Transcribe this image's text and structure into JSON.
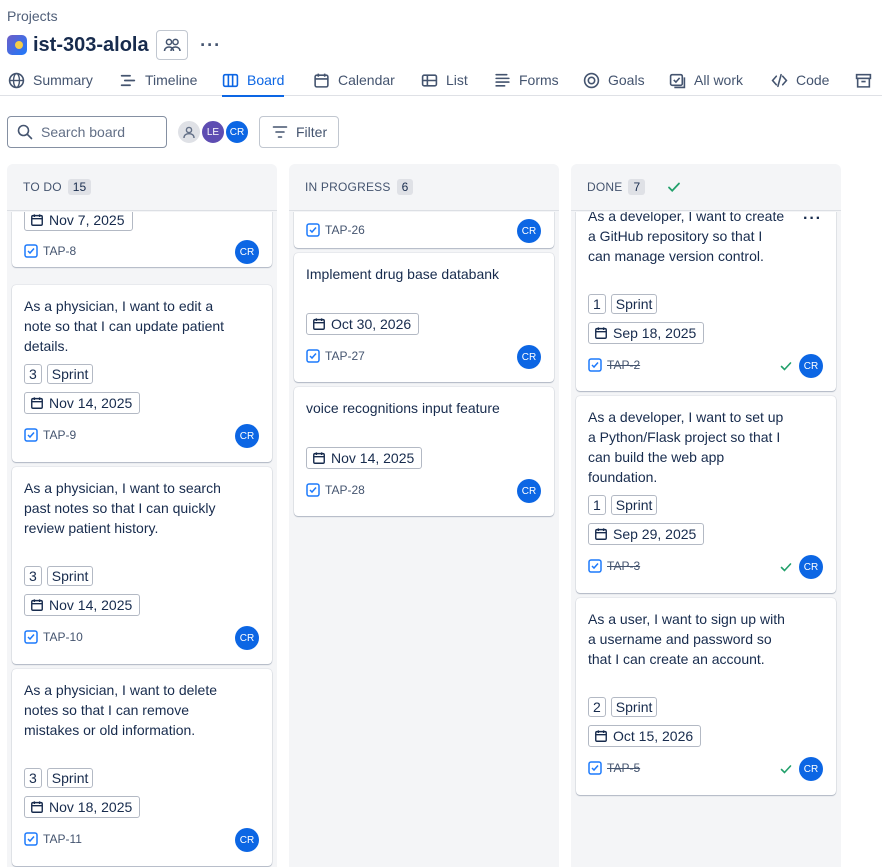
{
  "breadcrumb": "Projects",
  "project": {
    "name": "ist-303-alola"
  },
  "tabs": [
    {
      "label": "Summary",
      "icon": "globe-icon"
    },
    {
      "label": "Timeline",
      "icon": "timeline-icon"
    },
    {
      "label": "Board",
      "icon": "board-icon",
      "active": true
    },
    {
      "label": "Calendar",
      "icon": "calendar-icon"
    },
    {
      "label": "List",
      "icon": "list-icon"
    },
    {
      "label": "Forms",
      "icon": "forms-icon"
    },
    {
      "label": "Goals",
      "icon": "goals-icon"
    },
    {
      "label": "All work",
      "icon": "all-work-icon"
    },
    {
      "label": "Code",
      "icon": "code-icon"
    }
  ],
  "toolbar": {
    "search_placeholder": "Search board",
    "avatars": [
      "LE",
      "CR"
    ],
    "filter_label": "Filter"
  },
  "columns": [
    {
      "title": "TO DO",
      "count": "15",
      "cards": [
        {
          "date": "Nov 7, 2025",
          "key": "TAP-8",
          "assignee": "CR"
        },
        {
          "text": "As a physician, I want to edit a note so that I can update patient details.",
          "points": "3",
          "sprint": "Sprint",
          "date": "Nov 14, 2025",
          "key": "TAP-9",
          "assignee": "CR"
        },
        {
          "text": "As a physician, I want to search past notes so that I can quickly review patient history.",
          "points": "3",
          "sprint": "Sprint",
          "date": "Nov 14, 2025",
          "key": "TAP-10",
          "assignee": "CR"
        },
        {
          "text": "As a physician, I want to delete notes so that I can remove mistakes or old information.",
          "points": "3",
          "sprint": "Sprint",
          "date": "Nov 18, 2025",
          "key": "TAP-11",
          "assignee": "CR"
        }
      ]
    },
    {
      "title": "IN PROGRESS",
      "count": "6",
      "cards": [
        {
          "key": "TAP-26",
          "assignee": "CR"
        },
        {
          "text": "Implement drug base databank",
          "date": "Oct 30, 2026",
          "key": "TAP-27",
          "assignee": "CR"
        },
        {
          "text": "voice recognitions input feature",
          "date": "Nov 14, 2025",
          "key": "TAP-28",
          "assignee": "CR"
        }
      ]
    },
    {
      "title": "DONE",
      "count": "7",
      "cards": [
        {
          "text": "As a developer, I want to create a GitHub repository so that I can manage version control.",
          "points": "1",
          "sprint": "Sprint",
          "date": "Sep 18, 2025",
          "key": "TAP-2",
          "assignee": "CR"
        },
        {
          "text": "As a developer, I want to set up a Python/Flask project so that I can build the web app foundation.",
          "points": "1",
          "sprint": "Sprint",
          "date": "Sep 29, 2025",
          "key": "TAP-3",
          "assignee": "CR"
        },
        {
          "text": "As a user, I want to sign up with a username and password so that I can create an account.",
          "points": "2",
          "sprint": "Sprint",
          "date": "Oct 15, 2026",
          "key": "TAP-5",
          "assignee": "CR"
        }
      ]
    }
  ],
  "colors": {
    "accent": "#0c66e4",
    "avatar_purple": "#5e4db2",
    "done_green": "#22a06b"
  }
}
